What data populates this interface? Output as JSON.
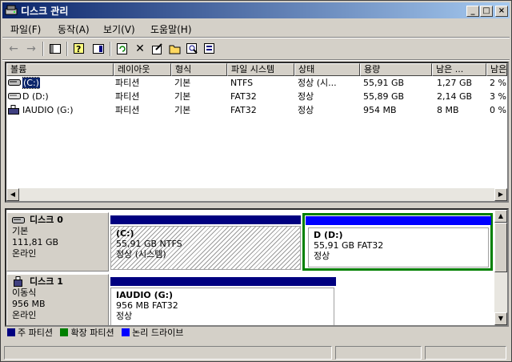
{
  "window": {
    "title": "디스크 관리"
  },
  "menu": [
    {
      "label": "파일(F)"
    },
    {
      "label": "동작(A)"
    },
    {
      "label": "보기(V)"
    },
    {
      "label": "도움말(H)"
    }
  ],
  "toolbar": {
    "icons": [
      "back-arrow-icon",
      "forward-arrow-icon",
      "console-tree-icon",
      "properties-icon",
      "show-hide-icon",
      "refresh-icon",
      "delete-icon",
      "settings-icon",
      "open-icon",
      "find-icon",
      "export-icon"
    ]
  },
  "volume_list": {
    "columns": [
      "볼륨",
      "레이아웃",
      "형식",
      "파일 시스템",
      "상태",
      "용량",
      "남은 ...",
      "남은"
    ],
    "rows": [
      {
        "volume": "(C:)",
        "layout": "파티션",
        "type": "기본",
        "fs": "NTFS",
        "status": "정상 (시...",
        "capacity": "55,91 GB",
        "free": "1,27 GB",
        "pct": "2 %"
      },
      {
        "volume": "D (D:)",
        "layout": "파티션",
        "type": "기본",
        "fs": "FAT32",
        "status": "정상",
        "capacity": "55,89 GB",
        "free": "2,14 GB",
        "pct": "3 %"
      },
      {
        "volume": "IAUDIO (G:)",
        "layout": "파티션",
        "type": "기본",
        "fs": "FAT32",
        "status": "정상",
        "capacity": "954 MB",
        "free": "8 MB",
        "pct": "0 %"
      }
    ]
  },
  "disks": [
    {
      "name": "디스크 0",
      "kind": "기본",
      "size": "111,81 GB",
      "state": "온라인",
      "partitions": [
        {
          "name": "(C:)",
          "info": "55,91 GB NTFS",
          "status": "정상 (시스템)"
        },
        {
          "name": "D  (D:)",
          "info": "55,91 GB FAT32",
          "status": "정상"
        }
      ]
    },
    {
      "name": "디스크 1",
      "kind": "이동식",
      "size": "956 MB",
      "state": "온라인",
      "partitions": [
        {
          "name": "IAUDIO  (G:)",
          "info": "956 MB FAT32",
          "status": "정상"
        }
      ]
    }
  ],
  "legend": [
    {
      "label": "주 파티션",
      "color": "#000080"
    },
    {
      "label": "확장 파티션",
      "color": "#008000"
    },
    {
      "label": "논리 드라이브",
      "color": "#0000ff"
    }
  ],
  "colors": {
    "title_start": "#0a246a",
    "title_end": "#a6caf0",
    "selection": "#0a246a",
    "primary": "#000080",
    "extended": "#008000"
  }
}
